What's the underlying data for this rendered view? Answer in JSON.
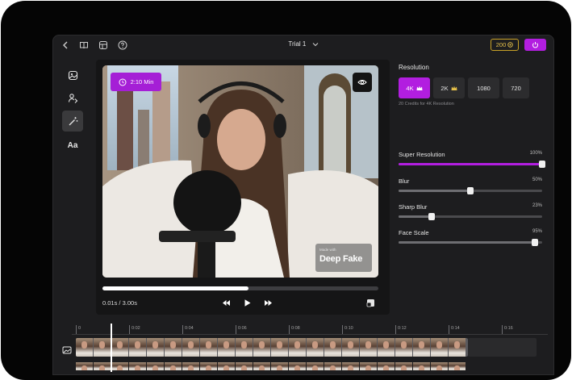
{
  "app": {
    "title": "Trial 1",
    "credits": "200",
    "accent_color": "#b21ee0"
  },
  "topbar_icons": [
    "back-arrow-icon",
    "book-icon",
    "layout-icon",
    "help-icon"
  ],
  "sidebar": {
    "items": [
      {
        "name": "image-icon"
      },
      {
        "name": "face-swap-icon"
      },
      {
        "name": "magic-wand-icon",
        "active": true
      },
      {
        "name": "text-icon",
        "label": "Aa"
      }
    ]
  },
  "player": {
    "duration_badge": "2:10 Min",
    "watermark_small": "Made with",
    "watermark_big": "Deep Fake",
    "timecode": "0.01s / 3.00s",
    "progress": 0.53
  },
  "settings": {
    "resolution_heading": "Resolution",
    "resolutions": [
      {
        "label": "4K",
        "crown": true,
        "selected": true
      },
      {
        "label": "2K",
        "crown": true,
        "selected": false
      },
      {
        "label": "1080",
        "crown": false,
        "selected": false
      },
      {
        "label": "720",
        "crown": false,
        "selected": false
      }
    ],
    "credits_note": "20 Credits for 4K Resolution",
    "sliders": [
      {
        "label": "Super Resolution",
        "value_text": "100%",
        "value": 1.0,
        "accent": true
      },
      {
        "label": "Blur",
        "value_text": "50%",
        "value": 0.5,
        "accent": false
      },
      {
        "label": "Sharp Blur",
        "value_text": "23%",
        "value": 0.23,
        "accent": false
      },
      {
        "label": "Face Scale",
        "value_text": "95%",
        "value": 0.95,
        "accent": false
      }
    ]
  },
  "timeline": {
    "ticks": [
      "0",
      "0:02",
      "0:04",
      "0:06",
      "0:08",
      "0:10",
      "0:12",
      "0:14",
      "0:16"
    ]
  }
}
